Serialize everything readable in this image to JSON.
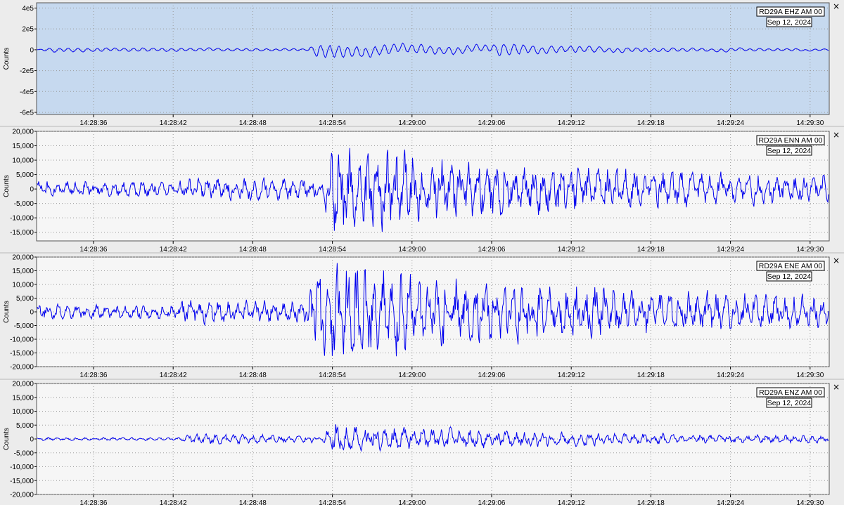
{
  "panels": [
    {
      "channel": "RD29A EHZ AM 00",
      "date": "Sep 12, 2024",
      "ylabel": "Counts",
      "close_glyph": "×",
      "selected": true,
      "ylim": [
        -620000,
        450000
      ],
      "yticks": [
        {
          "v": 400000,
          "t": "4e5"
        },
        {
          "v": 200000,
          "t": "2e5"
        },
        {
          "v": 0,
          "t": "0"
        },
        {
          "v": -200000,
          "t": "-2e5"
        },
        {
          "v": -400000,
          "t": "-4e5"
        },
        {
          "v": -600000,
          "t": "-6e5"
        }
      ],
      "trace": {
        "noise": 0.015,
        "bursts": [
          [
            0.0,
            0.3,
            2.2
          ],
          [
            0.34,
            0.9,
            3.3
          ],
          [
            0.57,
            0.6,
            18
          ]
        ],
        "onset": -0.5,
        "smooth": 0.9,
        "scale": 140000
      }
    },
    {
      "channel": "RD29A ENN AM 00",
      "date": "Sep 12, 2024",
      "ylabel": "Counts",
      "close_glyph": "×",
      "selected": false,
      "ylim": [
        -18000,
        20000
      ],
      "yticks": [
        {
          "v": 20000,
          "t": "20,000"
        },
        {
          "v": 15000,
          "t": "15,000"
        },
        {
          "v": 10000,
          "t": "10,000"
        },
        {
          "v": 5000,
          "t": "5,000"
        },
        {
          "v": 0,
          "t": "0"
        },
        {
          "v": -5000,
          "t": "-5,000"
        },
        {
          "v": -10000,
          "t": "-10,000"
        },
        {
          "v": -15000,
          "t": "-15,000"
        }
      ],
      "trace": {
        "noise": 0.18,
        "bursts": [
          [
            0.36,
            0.82,
            3.0
          ],
          [
            0.18,
            0.1,
            3
          ]
        ],
        "onset": -1,
        "smooth": 0.2,
        "scale": 14000
      }
    },
    {
      "channel": "RD29A ENE AM 00",
      "date": "Sep 12, 2024",
      "ylabel": "Counts",
      "close_glyph": "×",
      "selected": false,
      "ylim": [
        -20000,
        20000
      ],
      "yticks": [
        {
          "v": 20000,
          "t": "20,000"
        },
        {
          "v": 15000,
          "t": "15,000"
        },
        {
          "v": 10000,
          "t": "10,000"
        },
        {
          "v": 5000,
          "t": "5,000"
        },
        {
          "v": 0,
          "t": "0"
        },
        {
          "v": -5000,
          "t": "-5,000"
        },
        {
          "v": -10000,
          "t": "-10,000"
        },
        {
          "v": -15000,
          "t": "-15,000"
        },
        {
          "v": -20000,
          "t": "-20,000"
        }
      ],
      "trace": {
        "noise": 0.16,
        "bursts": [
          [
            0.34,
            0.95,
            2.4
          ],
          [
            0.17,
            0.12,
            3
          ]
        ],
        "onset": -1,
        "smooth": 0.2,
        "scale": 15000
      }
    },
    {
      "channel": "RD29A ENZ AM 00",
      "date": "Sep 12, 2024",
      "ylabel": "Counts",
      "close_glyph": "×",
      "selected": false,
      "ylim": [
        -20000,
        20000
      ],
      "yticks": [
        {
          "v": 20000,
          "t": "20,000"
        },
        {
          "v": 15000,
          "t": "15,000"
        },
        {
          "v": 10000,
          "t": "10,000"
        },
        {
          "v": 5000,
          "t": "5,000"
        },
        {
          "v": 0,
          "t": "0"
        },
        {
          "v": -5000,
          "t": "-5,000"
        },
        {
          "v": -10000,
          "t": "-10,000"
        },
        {
          "v": -15000,
          "t": "-15,000"
        },
        {
          "v": -20000,
          "t": "-20,000"
        }
      ],
      "trace": {
        "noise": 0.07,
        "bursts": [
          [
            0.18,
            0.2,
            4
          ],
          [
            0.36,
            0.55,
            3.0
          ]
        ],
        "onset": -1,
        "smooth": 0.3,
        "scale": 8000
      }
    }
  ],
  "xticks": [
    "14:28:36",
    "14:28:42",
    "14:28:48",
    "14:28:54",
    "14:29:00",
    "14:29:06",
    "14:29:12",
    "14:29:18",
    "14:29:24",
    "14:29:30"
  ],
  "colors": {
    "trace": "#0000ee",
    "selected_bg": "#c6d9ef",
    "plot_bg": "#f6f6f6",
    "grid": "#9a9a9a",
    "window_bg": "#ececec"
  }
}
